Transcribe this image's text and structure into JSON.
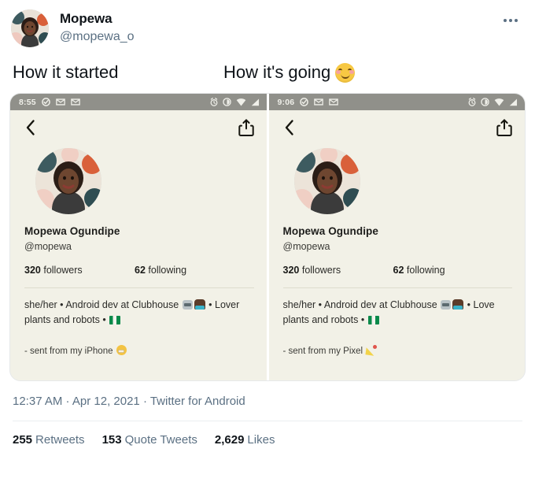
{
  "tweet": {
    "author": {
      "display_name": "Mopewa",
      "handle": "@mopewa_o",
      "avatar_alt": "mopewa-profile-photo"
    },
    "more_menu_label": "More",
    "body": {
      "left_caption": "How it started",
      "right_caption": "How it's going",
      "right_caption_emoji": "smiling-face-with-smiling-eyes"
    },
    "meta": {
      "time": "12:37 AM",
      "separator_1": "·",
      "date": "Apr 12, 2021",
      "separator_2": "·",
      "source": "Twitter for Android",
      "full_line": "12:37 AM · Apr 12, 2021 · Twitter for Android"
    },
    "stats": [
      {
        "count": "255",
        "label": "Retweets"
      },
      {
        "count": "153",
        "label": "Quote Tweets"
      },
      {
        "count": "2,629",
        "label": "Likes"
      }
    ]
  },
  "media": {
    "screenshots": [
      {
        "id": "how-it-started",
        "status_bar": {
          "time": "8:55",
          "left_icons": [
            "check-circle-icon",
            "mail-icon",
            "mail-icon"
          ],
          "right_icons": [
            "alarm-icon",
            "vibrate-icon",
            "wifi-icon",
            "signal-icon"
          ]
        },
        "nav": {
          "back_icon": "back-chevron-icon",
          "share_icon": "share-icon"
        },
        "profile": {
          "name": "Mopewa Ogundipe",
          "handle": "@mopewa",
          "followers_count": "320",
          "followers_label": "followers",
          "following_count": "62",
          "following_label": "following",
          "bio_line_1": "she/her • Android dev at Clubhouse",
          "bio_line_1_end": "• Lover",
          "bio_line_2": "plants and robots •",
          "bio_emoji": [
            "robot-emoji",
            "woman-technologist-emoji",
            "nigeria-flag-emoji"
          ],
          "signature": "- sent from my iPhone",
          "signature_emoji": "grimacing-face-emoji"
        }
      },
      {
        "id": "how-its-going",
        "status_bar": {
          "time": "9:06",
          "left_icons": [
            "check-circle-icon",
            "mail-icon",
            "mail-icon"
          ],
          "right_icons": [
            "alarm-icon",
            "vibrate-icon",
            "wifi-icon",
            "signal-icon"
          ]
        },
        "nav": {
          "back_icon": "back-chevron-icon",
          "share_icon": "share-icon"
        },
        "profile": {
          "name": "Mopewa Ogundipe",
          "handle": "@mopewa",
          "followers_count": "320",
          "followers_label": "followers",
          "following_count": "62",
          "following_label": "following",
          "bio_line_1": "she/her • Android dev at Clubhouse",
          "bio_line_1_end": "• Love",
          "bio_line_2": "plants and robots •",
          "bio_emoji": [
            "robot-emoji",
            "woman-technologist-emoji",
            "nigeria-flag-emoji"
          ],
          "signature": "- sent from my Pixel",
          "signature_emoji": "party-popper-emoji"
        }
      }
    ]
  },
  "colors": {
    "page_bg": "#ffffff",
    "text_primary": "#0f1419",
    "text_secondary": "#5b7083",
    "card_bg": "#f2f1e7",
    "status_bar": "#90908a",
    "border": "#e6e8ea"
  }
}
